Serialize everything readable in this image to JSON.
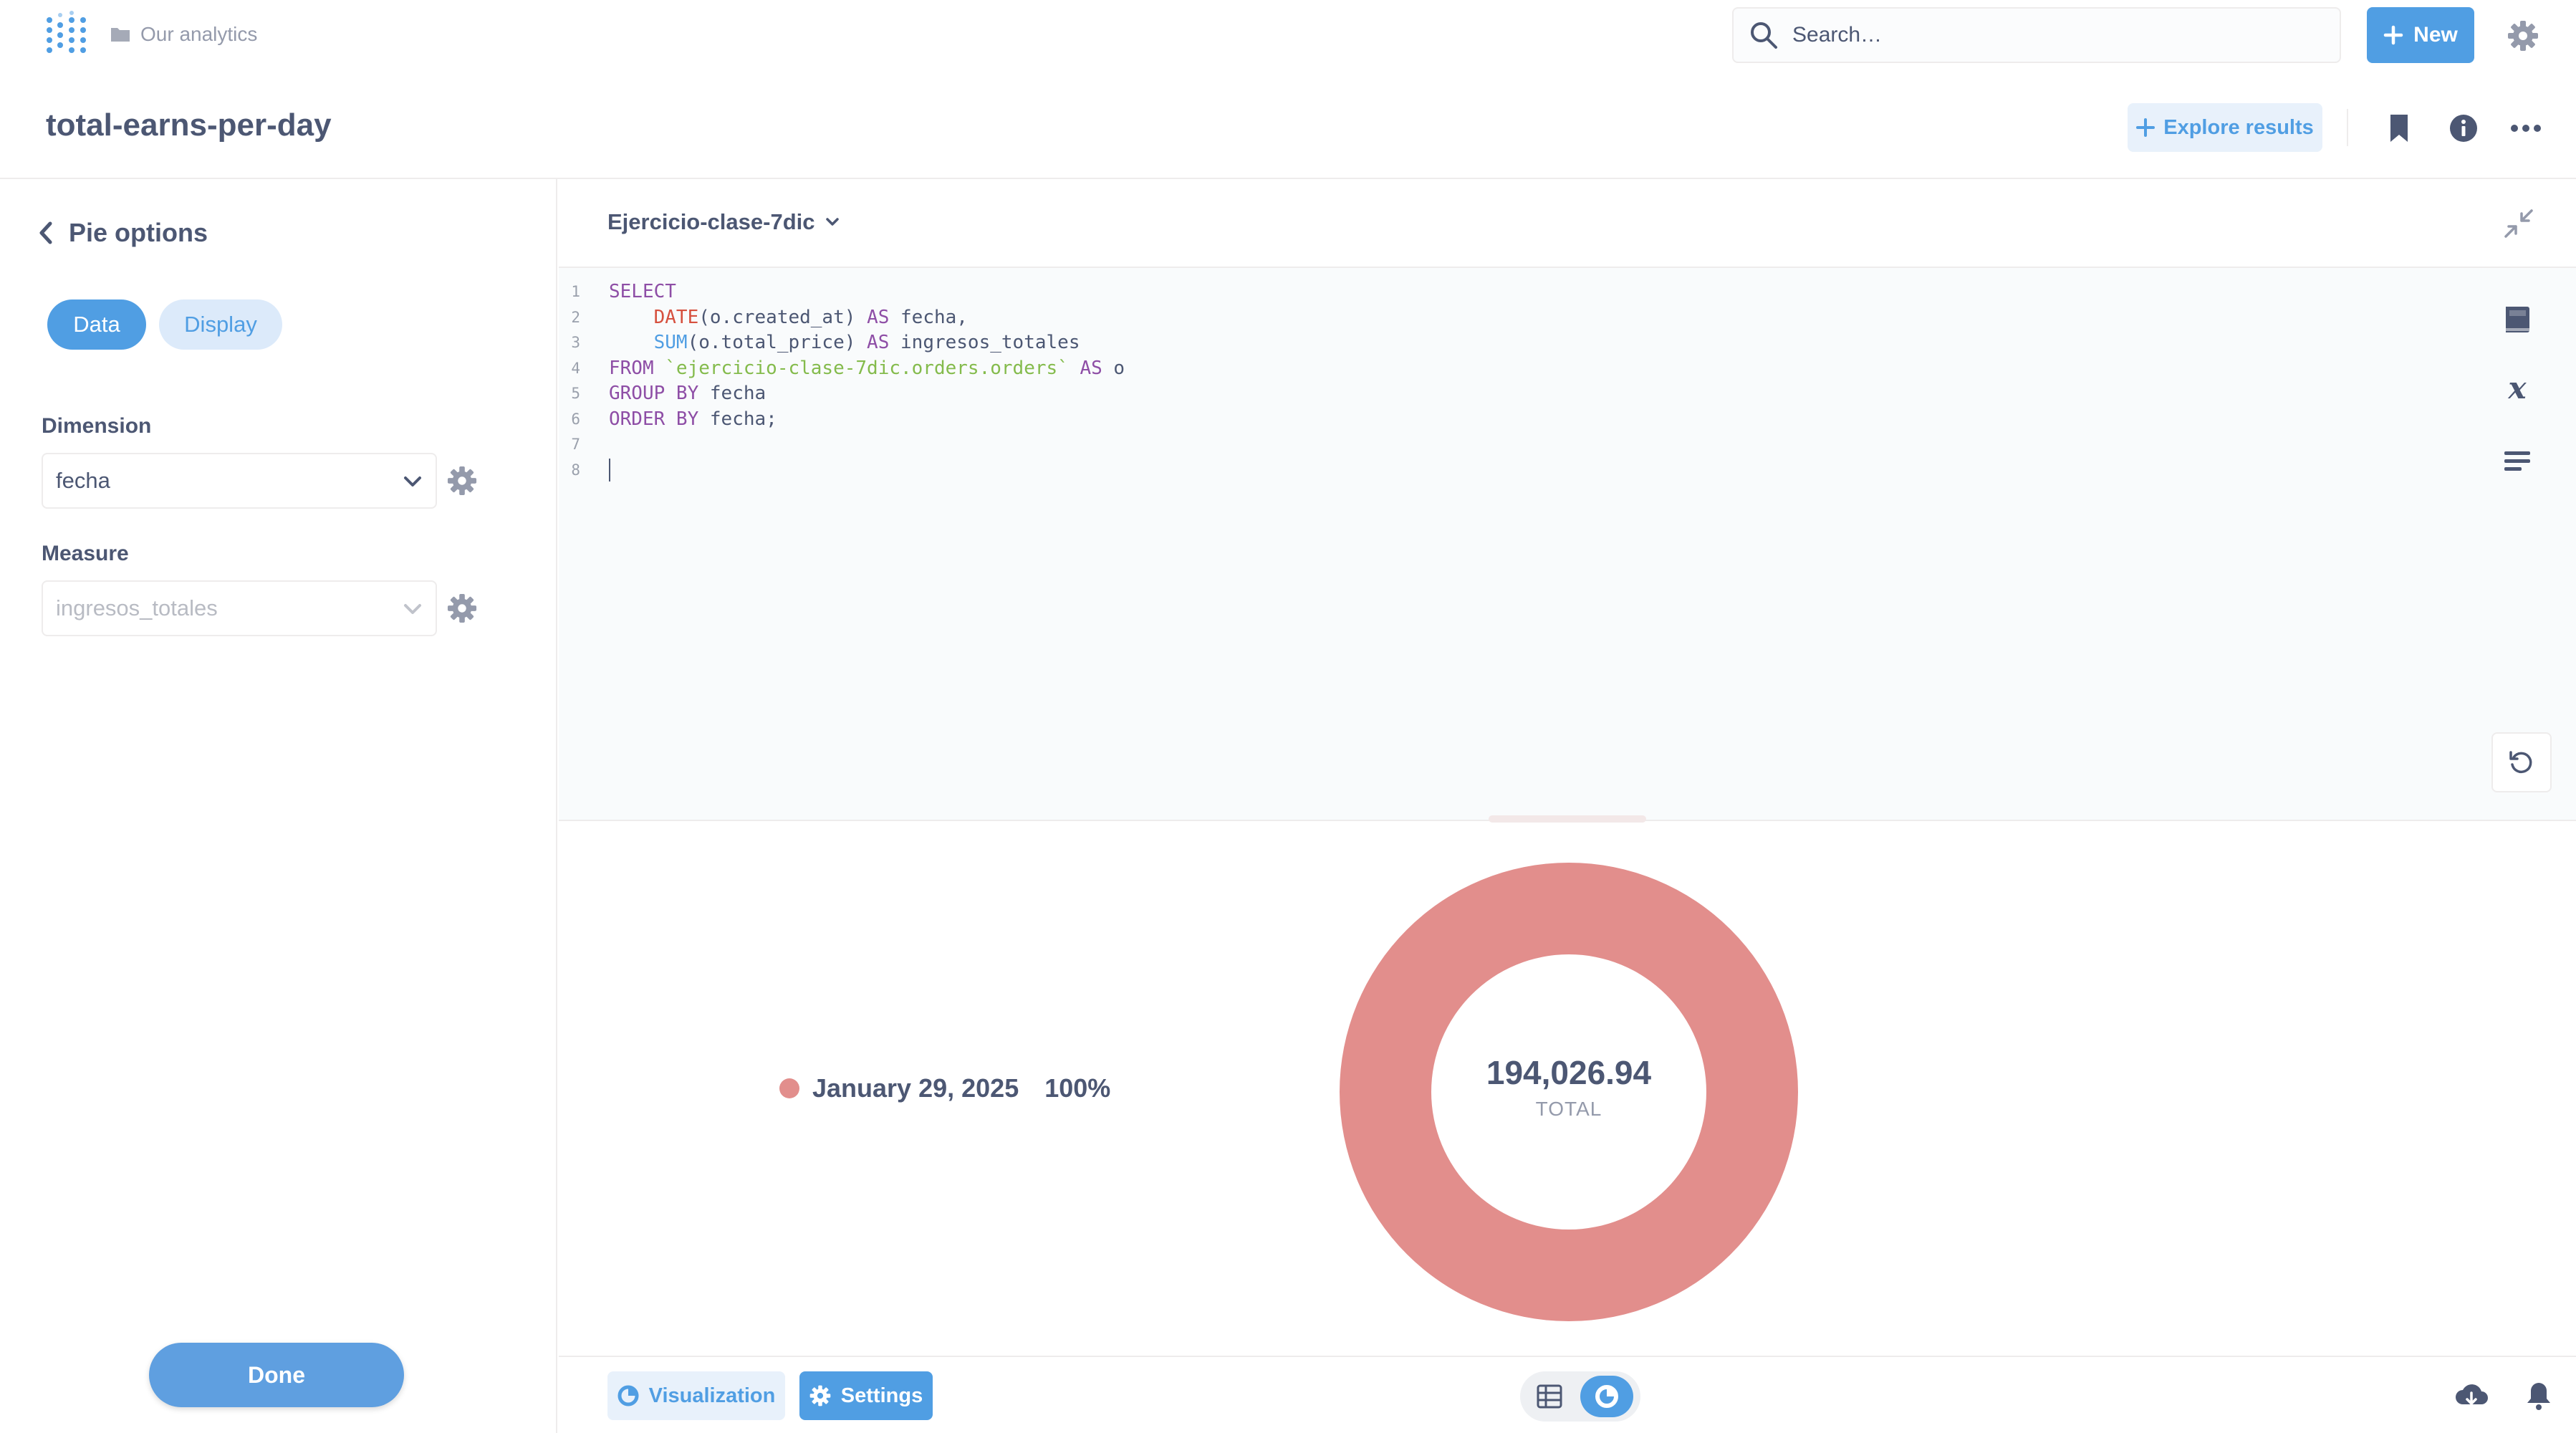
{
  "topbar": {
    "breadcrumb": "Our analytics",
    "search_placeholder": "Search…",
    "new_label": "New"
  },
  "question": {
    "title": "total-earns-per-day",
    "explore_label": "Explore results"
  },
  "sidebar": {
    "header": "Pie options",
    "tabs": {
      "data": "Data",
      "display": "Display"
    },
    "dimension": {
      "label": "Dimension",
      "value": "fecha"
    },
    "measure": {
      "label": "Measure",
      "value": "ingresos_totales"
    },
    "done_label": "Done"
  },
  "editor": {
    "database": "Ejercicio-clase-7dic",
    "line_numbers": [
      "1",
      "2",
      "3",
      "4",
      "5",
      "6",
      "7",
      "8"
    ]
  },
  "viz": {
    "legend_label": "January 29, 2025",
    "legend_percent": "100%",
    "total_value": "194,026.94",
    "total_label": "TOTAL",
    "slice_color": "#e28e8c"
  },
  "chart_data": {
    "type": "pie",
    "categories": [
      "January 29, 2025"
    ],
    "values": [
      194026.94
    ],
    "colors": [
      "#e28e8c"
    ]
  },
  "bottombar": {
    "visualization_label": "Visualization",
    "settings_label": "Settings"
  },
  "colors": {
    "brand": "#509ee3",
    "text": "#4c5773",
    "slice": "#e28e8c"
  }
}
